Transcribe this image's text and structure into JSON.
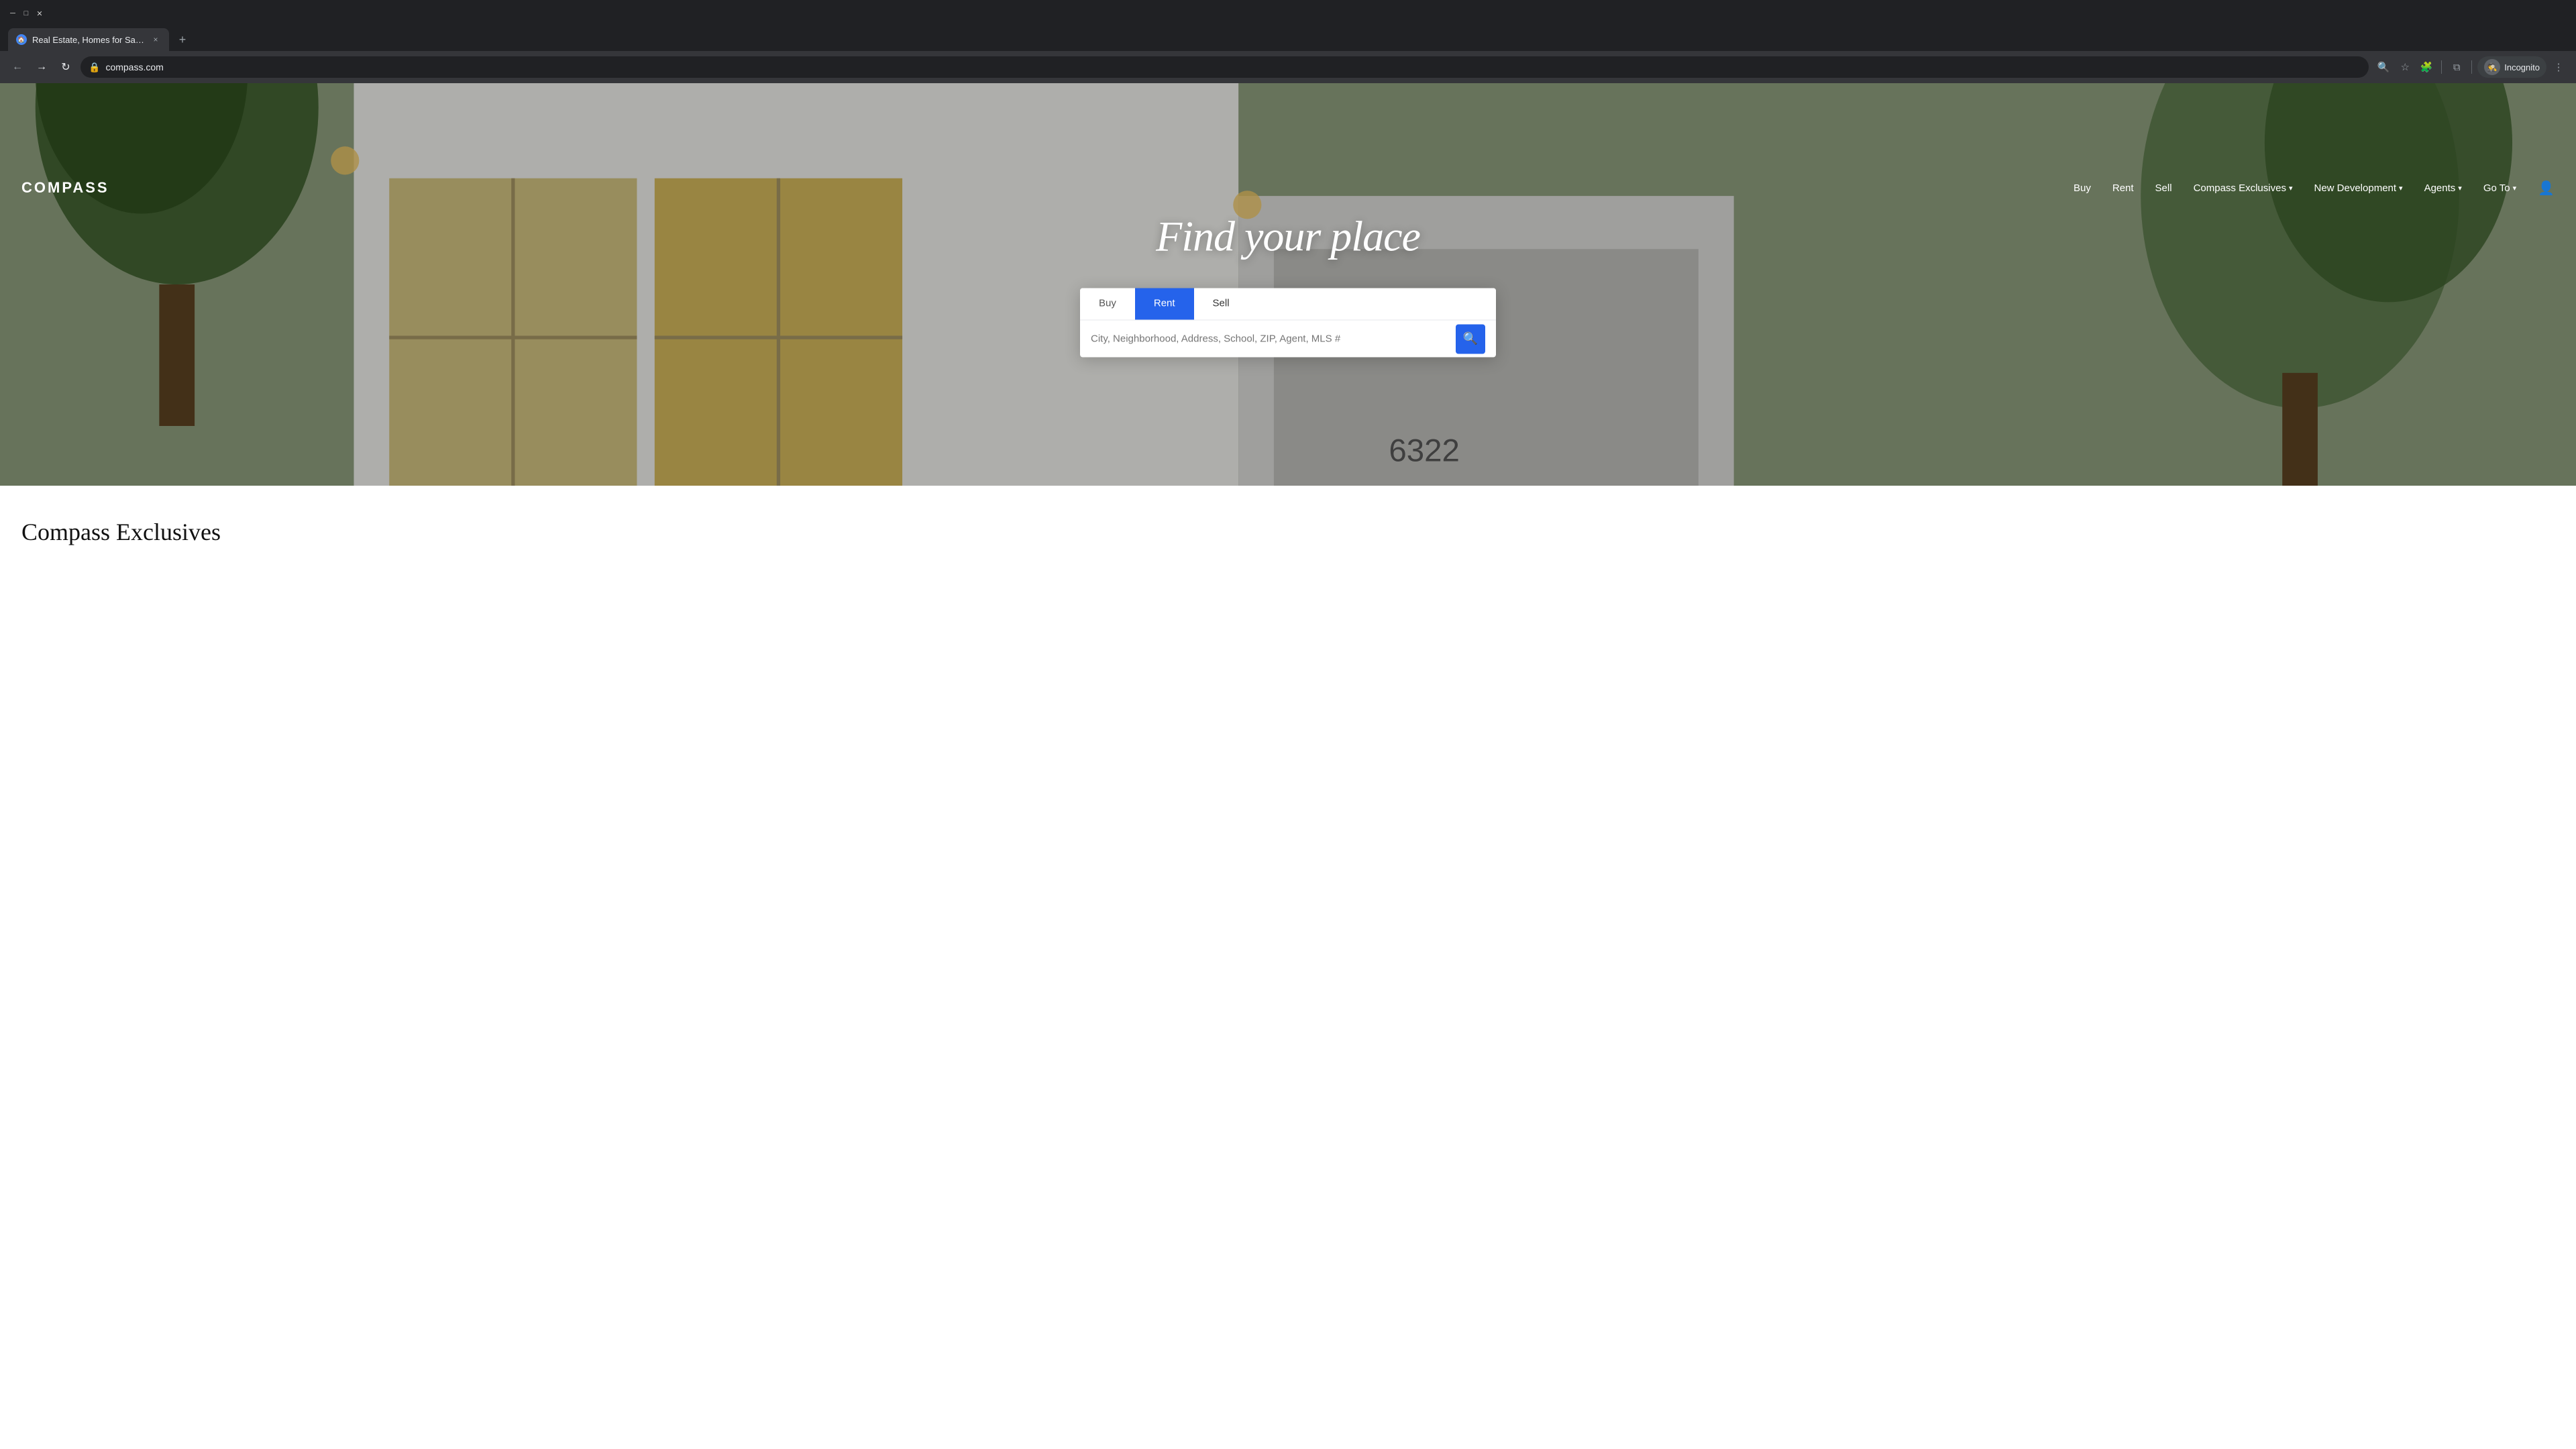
{
  "browser": {
    "tab": {
      "title": "Real Estate, Homes for Sale & A",
      "favicon": "🏠",
      "close_label": "×"
    },
    "new_tab_label": "+",
    "address": "compass.com",
    "nav": {
      "back_title": "←",
      "forward_title": "→",
      "refresh_title": "↻",
      "search_icon": "🔍",
      "bookmark_icon": "☆",
      "extensions_icon": "🧩",
      "split_icon": "⧉",
      "incognito_label": "Incognito",
      "more_icon": "⋮"
    }
  },
  "site": {
    "logo": "COMPASS",
    "nav": {
      "buy": "Buy",
      "rent": "Rent",
      "sell": "Sell",
      "exclusives": "Compass Exclusives",
      "new_dev": "New Development",
      "agents": "Agents",
      "goto": "Go To"
    },
    "hero": {
      "title": "Find your place"
    },
    "search": {
      "tabs": [
        {
          "label": "Buy",
          "active": false
        },
        {
          "label": "Rent",
          "active": true
        },
        {
          "label": "Sell",
          "active": false
        }
      ],
      "placeholder": "City, Neighborhood, Address, School, ZIP, Agent, MLS #",
      "button_icon": "🔍"
    },
    "below_hero": {
      "section_title": "Compass Exclusives"
    }
  }
}
